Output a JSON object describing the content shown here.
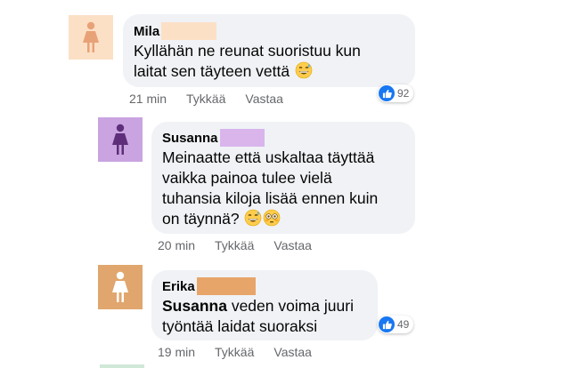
{
  "comments": [
    {
      "author": "Mila",
      "redact_color": "#fce0c6",
      "avatar_bg": "#fce0c6",
      "avatar_fg": "#e8a277",
      "lines": [
        "Kyllähän ne reunat suoristuu kun",
        "laitat sen täyteen vettä"
      ],
      "emojis": [
        "grinning-sweat-emoji"
      ],
      "time": "21 min",
      "like_label": "Tykkää",
      "reply_label": "Vastaa",
      "reaction_count": "92"
    },
    {
      "author": "Susanna",
      "redact_color": "#d9b5ec",
      "avatar_bg": "#c9a4e0",
      "avatar_fg": "#5e2e7a",
      "lines": [
        "Meinaatte että uskaltaa täyttää",
        "vaikka painoa tulee vielä",
        "tuhansia kiloja lisää ennen kuin",
        "on täynnä?"
      ],
      "emojis": [
        "grinning-sweat-emoji",
        "flushed-emoji"
      ],
      "time": "20 min",
      "like_label": "Tykkää",
      "reply_label": "Vastaa",
      "reaction_count": ""
    },
    {
      "author": "Erika",
      "redact_color": "#e8a56a",
      "avatar_bg": "#e0a66d",
      "avatar_fg": "#ffffff",
      "mention": "Susanna",
      "lines": [
        " veden voima juuri",
        "työntää laidat suoraksi"
      ],
      "emojis": [],
      "time": "19 min",
      "like_label": "Tykkää",
      "reply_label": "Vastaa",
      "reaction_count": "49"
    }
  ]
}
